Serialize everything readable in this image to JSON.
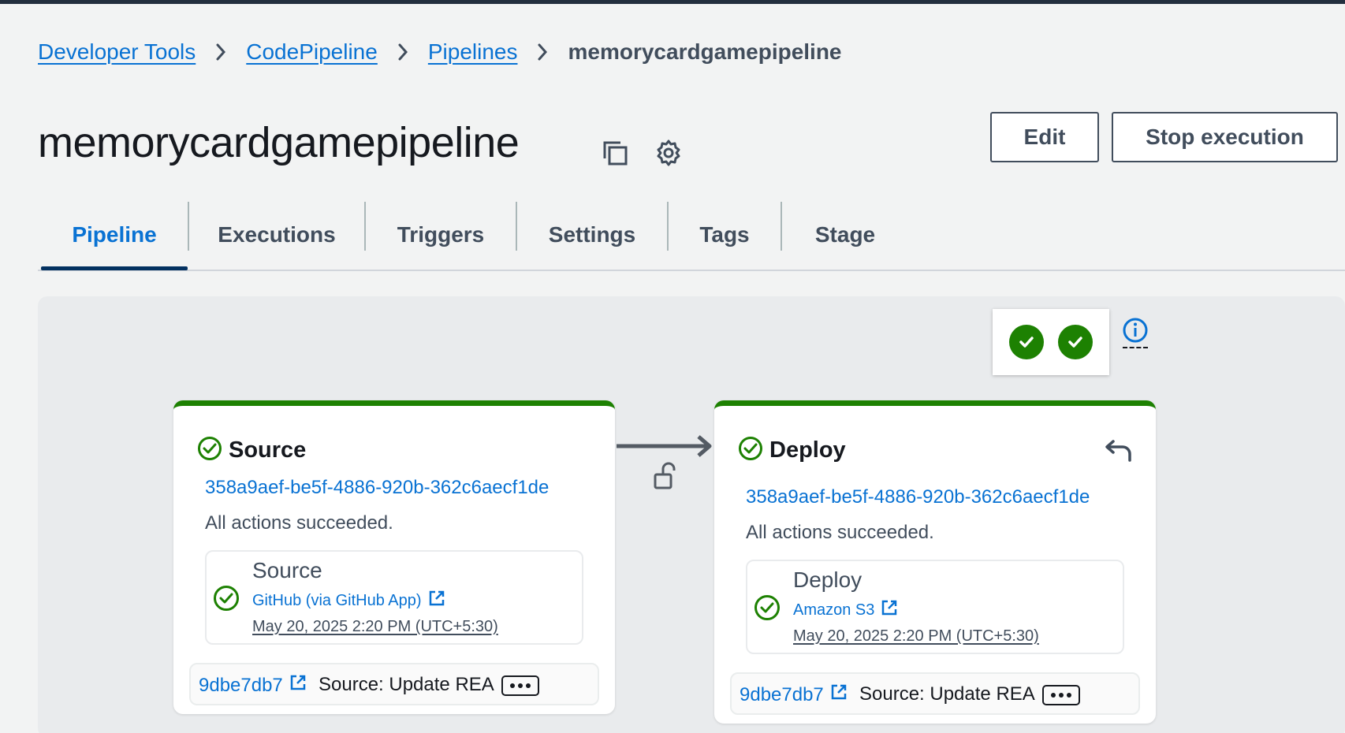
{
  "breadcrumb": {
    "items": [
      "Developer Tools",
      "CodePipeline",
      "Pipelines"
    ],
    "current": "memorycardgamepipeline"
  },
  "page": {
    "title": "memorycardgamepipeline"
  },
  "actions": {
    "edit": "Edit",
    "stop": "Stop execution"
  },
  "tabs": [
    {
      "label": "Pipeline",
      "active": true
    },
    {
      "label": "Executions"
    },
    {
      "label": "Triggers"
    },
    {
      "label": "Settings"
    },
    {
      "label": "Tags"
    },
    {
      "label": "Stage"
    }
  ],
  "colors": {
    "success": "#1d8102",
    "link": "#0972d3",
    "tab_active": "#0972d3"
  },
  "stages": [
    {
      "name": "Source",
      "execution_id": "358a9aef-be5f-4886-920b-362c6aecf1de",
      "status": "All actions succeeded.",
      "action": {
        "name": "Source",
        "provider": "GitHub (via GitHub App)",
        "time": "May 20, 2025 2:20 PM (UTC+5:30)"
      },
      "commit": {
        "id": "9dbe7db7",
        "message": "Source: Update REA"
      }
    },
    {
      "name": "Deploy",
      "execution_id": "358a9aef-be5f-4886-920b-362c6aecf1de",
      "status": "All actions succeeded.",
      "action": {
        "name": "Deploy",
        "provider": "Amazon S3",
        "time": "May 20, 2025 2:20 PM (UTC+5:30)"
      },
      "commit": {
        "id": "9dbe7db7",
        "message": "Source: Update REA"
      }
    }
  ],
  "icons": [
    "chevron-right-icon",
    "copy-icon",
    "settings-gear-icon",
    "check-circle-icon",
    "info-icon",
    "external-link-icon",
    "unlock-icon",
    "arrow-right-icon",
    "rollback-icon",
    "ellipsis-icon"
  ]
}
